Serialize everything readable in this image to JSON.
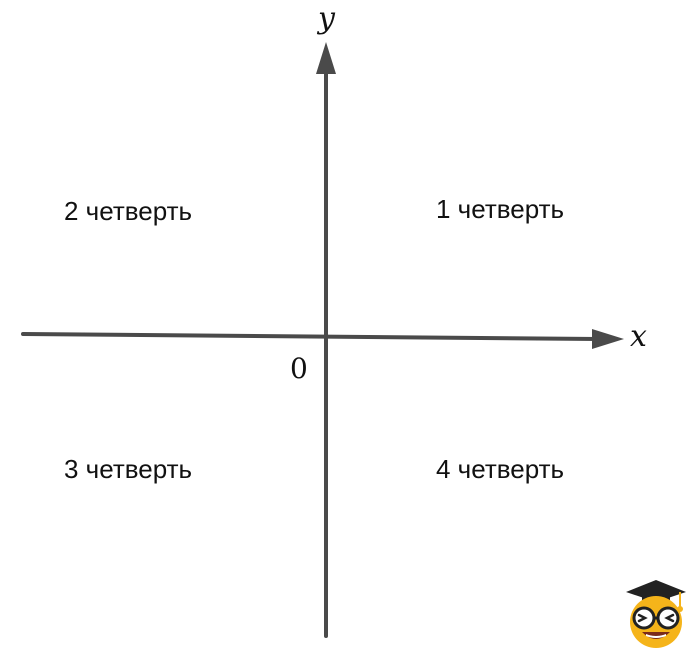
{
  "axes": {
    "x_label": "x",
    "y_label": "y",
    "origin_label": "0",
    "axis_color": "#4a4a4a"
  },
  "quadrants": {
    "q1": "1 четверть",
    "q2": "2 четверть",
    "q3": "3 четверть",
    "q4": "4 четверть"
  },
  "mascot": {
    "icon": "nerd-emoji-graduation-cap-icon",
    "face_color": "#f5b41a",
    "cap_color": "#222222"
  }
}
